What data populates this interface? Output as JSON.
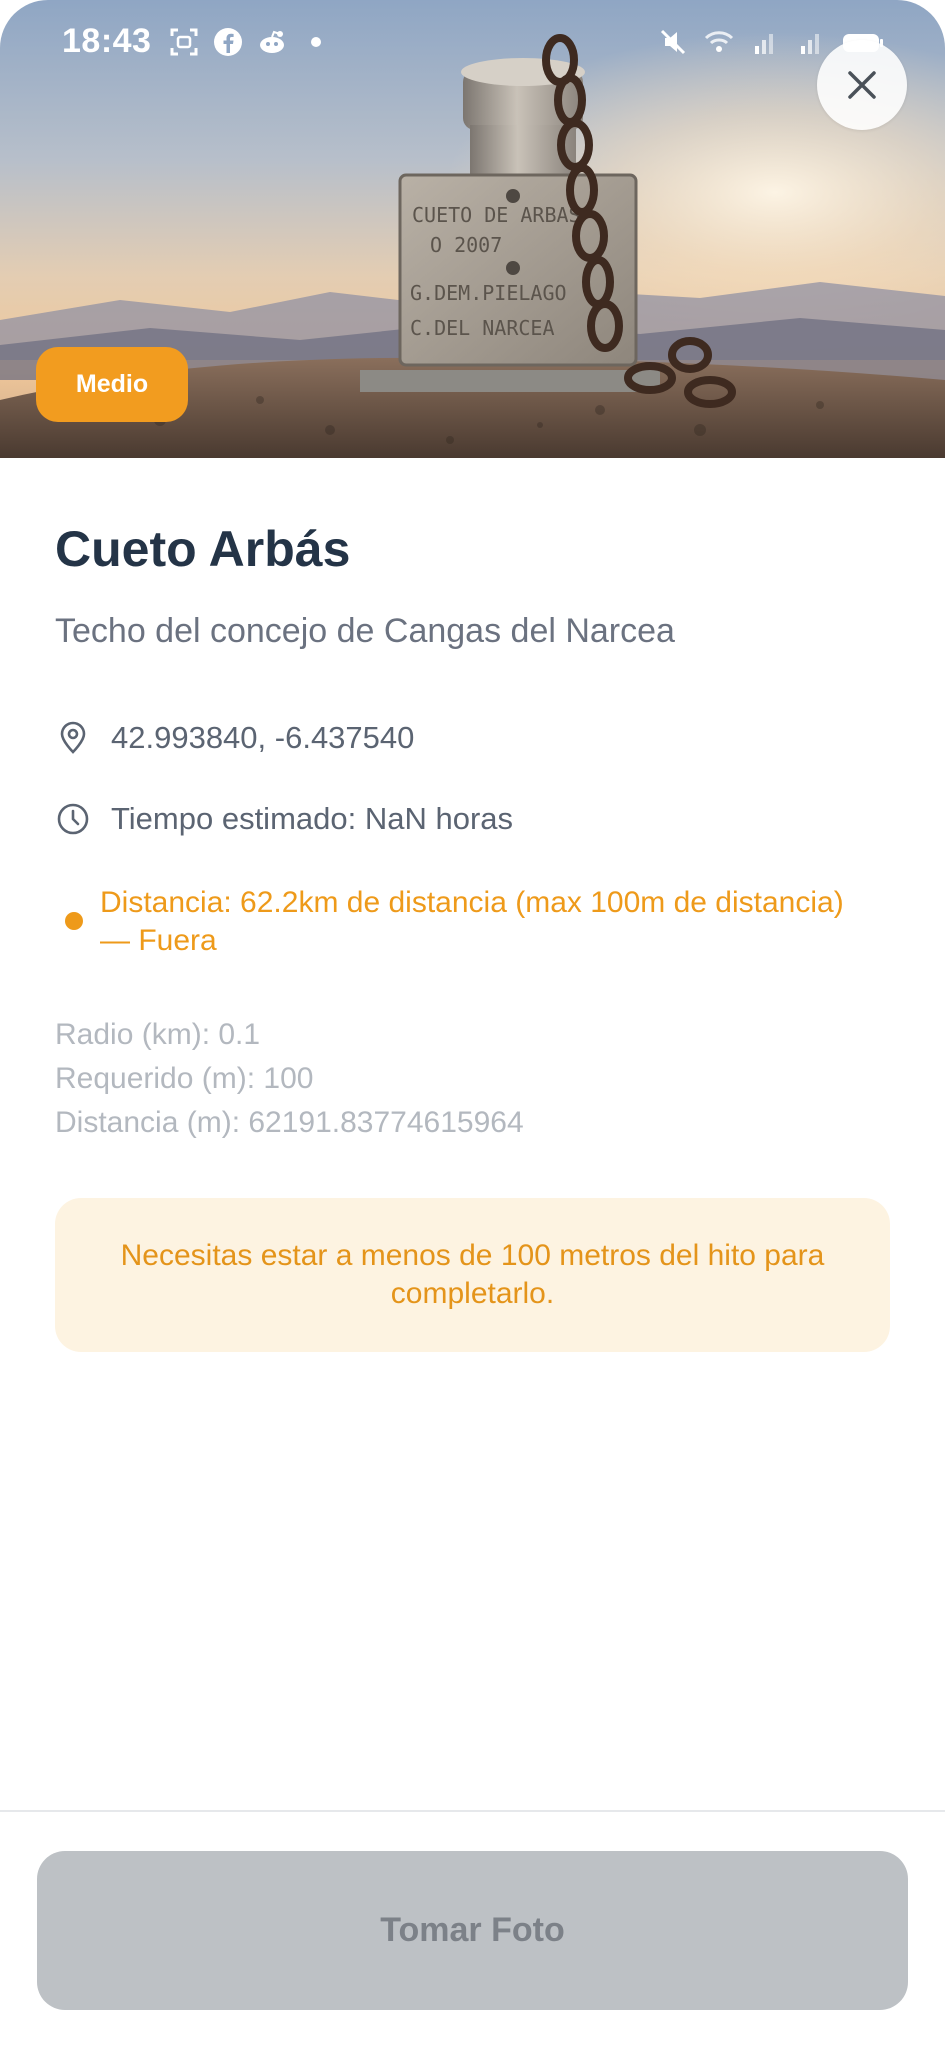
{
  "status_bar": {
    "time": "18:43",
    "left_icons": [
      "screenshot-icon",
      "facebook-icon",
      "reddit-icon",
      "dot-icon"
    ],
    "right_icons": [
      "mute-icon",
      "wifi-icon",
      "signal-icon",
      "signal-icon",
      "battery-icon"
    ]
  },
  "hero": {
    "image": "summit-marker-photo",
    "difficulty_badge": "Medio",
    "close_icon": "close-icon"
  },
  "peak": {
    "title": "Cueto Arbás",
    "subtitle": "Techo del concejo de Cangas del Narcea",
    "coordinates": "42.993840, -6.437540",
    "estimated_time": "Tiempo estimado: NaN horas",
    "distance_status": "Distancia: 62.2km de distancia (max 100m de distancia) — Fuera"
  },
  "debug": {
    "radio": "Radio (km): 0.1",
    "requerido": "Requerido (m): 100",
    "distancia": "Distancia (m): 62191.83774615964"
  },
  "notice": {
    "text": "Necesitas estar a menos de 100 metros del hito para completarlo."
  },
  "actions": {
    "take_photo_label": "Tomar Foto"
  },
  "colors": {
    "badge": "#F29C1F",
    "warning_text": "#EE9A1A",
    "notice_bg": "#FDF3E1",
    "title": "#243447",
    "button_disabled": "#BDC1C5"
  }
}
